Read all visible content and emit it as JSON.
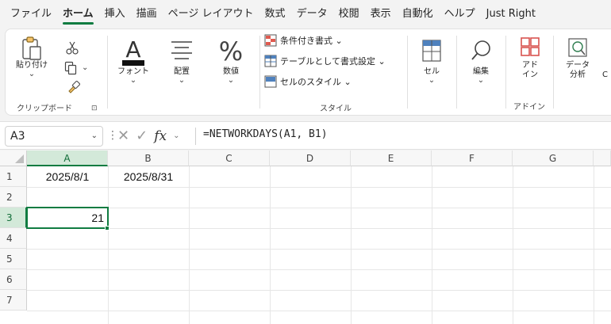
{
  "tabs": [
    {
      "label": "ファイル",
      "active": false
    },
    {
      "label": "ホーム",
      "active": true
    },
    {
      "label": "挿入",
      "active": false
    },
    {
      "label": "描画",
      "active": false
    },
    {
      "label": "ページ レイアウト",
      "active": false
    },
    {
      "label": "数式",
      "active": false
    },
    {
      "label": "データ",
      "active": false
    },
    {
      "label": "校閲",
      "active": false
    },
    {
      "label": "表示",
      "active": false
    },
    {
      "label": "自動化",
      "active": false
    },
    {
      "label": "ヘルプ",
      "active": false
    },
    {
      "label": "Just Right",
      "active": false
    }
  ],
  "ribbon": {
    "clipboard": {
      "paste_label": "貼り付け",
      "group_label": "クリップボード",
      "launcher": "⊡"
    },
    "font": {
      "label": "フォント"
    },
    "alignment": {
      "label": "配置"
    },
    "number": {
      "label": "数値",
      "symbol": "%"
    },
    "styles": {
      "conditional_format": "条件付き書式 ⌄",
      "format_as_table": "テーブルとして書式設定 ⌄",
      "cell_styles": "セルのスタイル ⌄",
      "group_label": "スタイル"
    },
    "cells": {
      "label": "セル"
    },
    "editing": {
      "label": "編集"
    },
    "addins": {
      "button_line1": "アド",
      "button_line2": "イン",
      "group_label": "アドイン"
    },
    "analysis": {
      "button_line1": "データ",
      "button_line2": "分析",
      "cut_off": "C"
    }
  },
  "formula_bar": {
    "name_box": "A3",
    "fx": "fx",
    "formula": "=NETWORKDAYS(A1, B1)"
  },
  "grid": {
    "columns": [
      "A",
      "B",
      "C",
      "D",
      "E",
      "F",
      "G"
    ],
    "selected_column": "A",
    "rows": [
      "1",
      "2",
      "3",
      "4",
      "5",
      "6",
      "7"
    ],
    "selected_row": "3",
    "cells": {
      "A1": "2025/8/1",
      "B1": "2025/8/31",
      "A3": "21"
    }
  },
  "colors": {
    "accent": "#107c41",
    "selected_header_bg": "#d3e9d9"
  }
}
